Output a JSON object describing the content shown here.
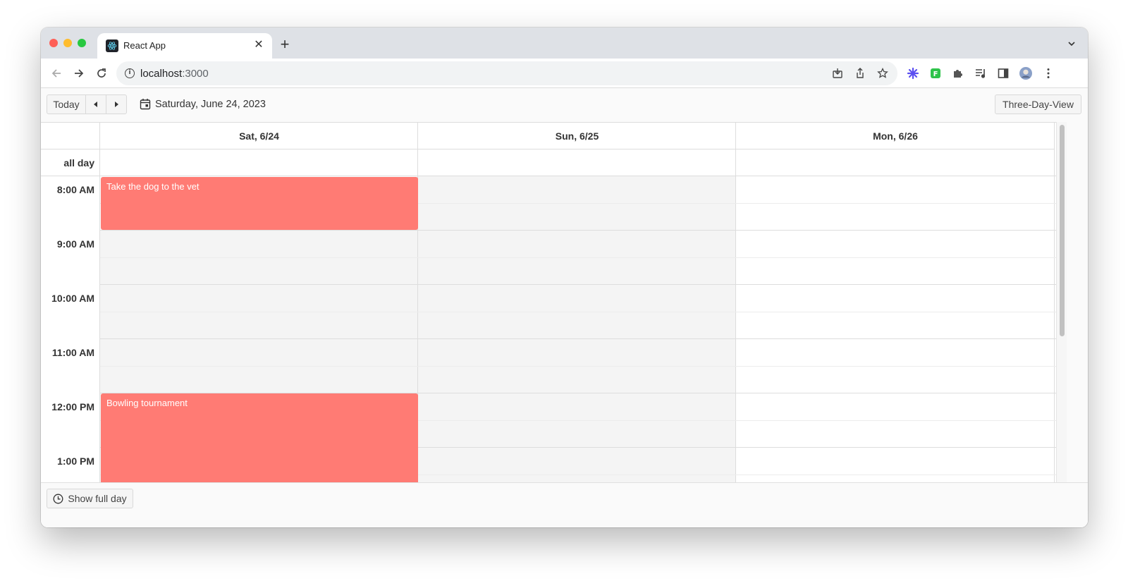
{
  "browser": {
    "tab_title": "React App",
    "url_host": "localhost",
    "url_port": ":3000",
    "icons": [
      "back-arrow-icon",
      "forward-arrow-icon",
      "reload-icon",
      "info-icon",
      "install-icon",
      "share-icon",
      "star-icon",
      "extension-snowflake-icon",
      "extension-f-icon",
      "puzzle-icon",
      "media-icon",
      "side-panel-icon",
      "profile-avatar",
      "more-menu-icon"
    ]
  },
  "calendar": {
    "today_label": "Today",
    "current_date": "Saturday, June 24, 2023",
    "view_label": "Three-Day-View",
    "days": [
      "Sat, 6/24",
      "Sun, 6/25",
      "Mon, 6/26"
    ],
    "all_day_label": "all day",
    "time_labels": [
      "8:00 AM",
      "9:00 AM",
      "10:00 AM",
      "11:00 AM",
      "12:00 PM",
      "1:00 PM"
    ],
    "events": [
      {
        "title": "Take the dog to the vet",
        "day": "Sat, 6/24",
        "start": "8:00 AM",
        "end": "9:00 AM"
      },
      {
        "title": "Bowling tournament",
        "day": "Sat, 6/24",
        "start": "12:00 PM"
      }
    ],
    "show_full_day_label": "Show full day",
    "event_color": "#ff7b74",
    "shaded_color": "#f4f4f4"
  }
}
